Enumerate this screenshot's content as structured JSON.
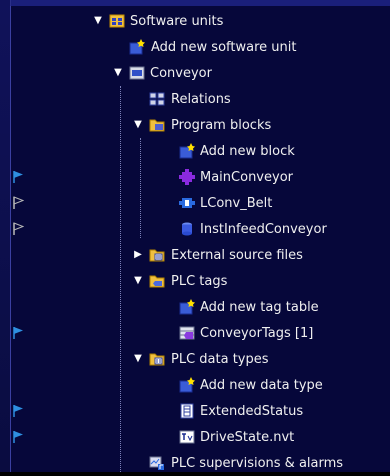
{
  "tree": {
    "items": [
      {
        "label": "Software units",
        "icon": "software-units-icon",
        "expanded": true
      },
      {
        "label": "Add new software unit",
        "icon": "add-new-icon"
      },
      {
        "label": "Conveyor",
        "icon": "unit-folder-icon",
        "expanded": true
      },
      {
        "label": "Relations",
        "icon": "relations-icon"
      },
      {
        "label": "Program blocks",
        "icon": "program-blocks-folder-icon",
        "expanded": true
      },
      {
        "label": "Add new block",
        "icon": "add-new-icon"
      },
      {
        "label": "MainConveyor",
        "icon": "ob-block-icon",
        "flag": "blue"
      },
      {
        "label": "LConv_Belt",
        "icon": "fb-block-icon",
        "flag": "grey"
      },
      {
        "label": "InstInfeedConveyor",
        "icon": "db-block-icon",
        "flag": "grey"
      },
      {
        "label": "External source files",
        "icon": "source-files-folder-icon",
        "expanded": false
      },
      {
        "label": "PLC tags",
        "icon": "plc-tags-folder-icon",
        "expanded": true
      },
      {
        "label": "Add new tag table",
        "icon": "add-new-icon"
      },
      {
        "label": "ConveyorTags [1]",
        "icon": "tag-table-icon",
        "flag": "blue"
      },
      {
        "label": "PLC data types",
        "icon": "data-types-folder-icon",
        "expanded": true
      },
      {
        "label": "Add new data type",
        "icon": "add-new-icon"
      },
      {
        "label": "ExtendedStatus",
        "icon": "struct-type-icon",
        "flag": "blue"
      },
      {
        "label": "DriveState.nvt",
        "icon": "types-icon",
        "flag": "blue"
      },
      {
        "label": "PLC supervisions & alarms",
        "icon": "supervision-icon"
      }
    ]
  },
  "colors": {
    "background": "#06073a",
    "flag_blue": "#2e8fe0",
    "flag_grey": "#b8b8b8",
    "text": "#f0f0f0"
  }
}
